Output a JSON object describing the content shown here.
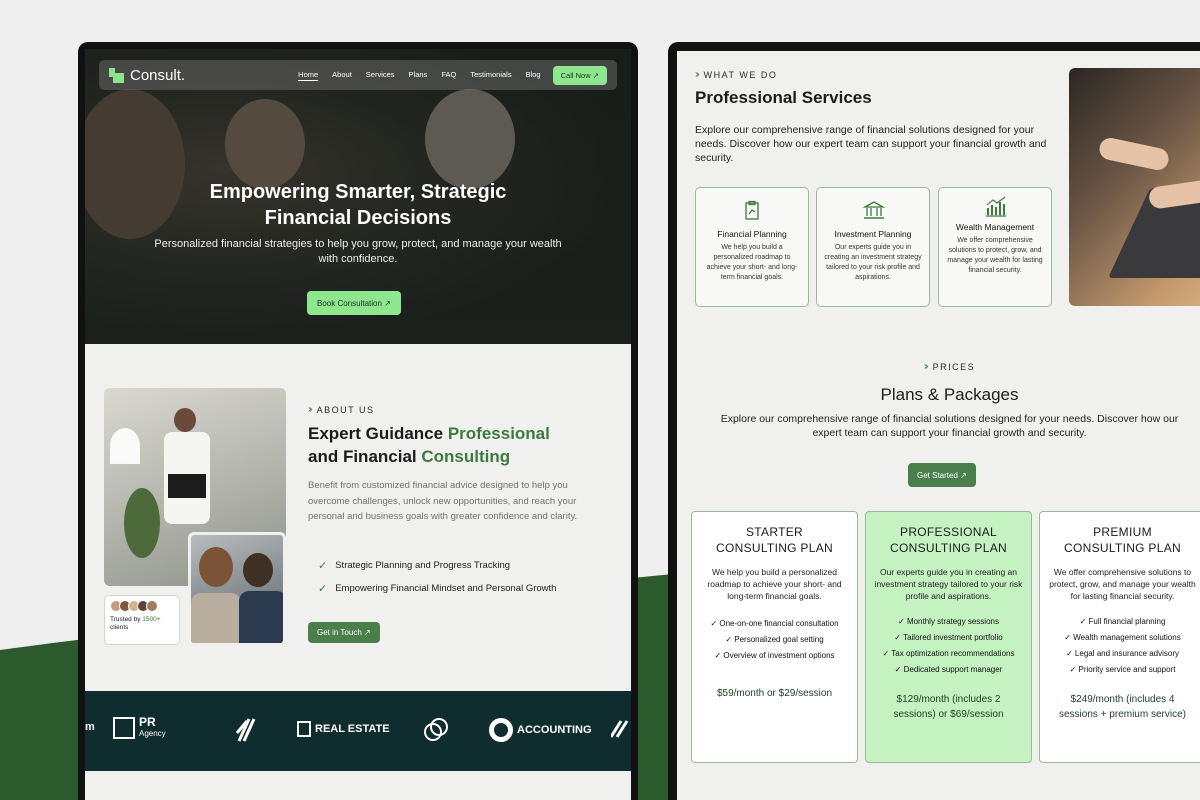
{
  "colors": {
    "accent": "#3d7a3e",
    "bright_green": "#8ee68e",
    "dark_teal": "#0f2d2e"
  },
  "left": {
    "nav": {
      "logo": "Consult.",
      "items": [
        "Home",
        "About",
        "Services",
        "Plans",
        "FAQ",
        "Testimonials",
        "Blog"
      ],
      "cta": "Call Now ↗"
    },
    "hero": {
      "title_line1": "Empowering Smarter, Strategic",
      "title_line2": "Financial Decisions",
      "subtitle": "Personalized financial strategies to help you grow, protect, and manage your wealth with confidence.",
      "button": "Book Consultation ↗"
    },
    "about": {
      "tag": "ABOUT US",
      "title_a": "Expert Guidance ",
      "title_b": "Professional",
      "title_c": "and Financial ",
      "title_d": "Consulting",
      "desc": "Benefit from customized financial advice designed to help you overcome challenges, unlock new opportunities, and reach your personal and business goals with greater confidence and clarity.",
      "checks": [
        "Strategic Planning and Progress Tracking",
        "Empowering Financial Mindset and Personal Growth"
      ],
      "button": "Get in Touch ↗",
      "trust_pre": "Trusted by ",
      "trust_count": "1500+",
      "trust_post": "clients"
    },
    "logos": {
      "partial": "m",
      "pr": "PR",
      "pr_sub": "Agency",
      "realestate": "REAL ESTATE",
      "accounting": "ACCOUNTING"
    }
  },
  "right": {
    "services": {
      "tag": "WHAT WE DO",
      "title": "Professional Services",
      "desc": "Explore our comprehensive range of financial solutions designed for your needs.  Discover how our expert team can support your financial growth and security.",
      "cards": [
        {
          "title": "Financial Planning",
          "desc": "We help you build a personalized roadmap to achieve your short- and long-term financial goals.",
          "icon": "clipboard-chart-icon"
        },
        {
          "title": "Investment Planning",
          "desc": "Our experts guide you in creating an investment strategy tailored to your risk profile and aspirations.",
          "icon": "bank-icon"
        },
        {
          "title": "Wealth Management",
          "desc": "We offer comprehensive solutions to protect, grow, and manage your wealth for lasting financial security.",
          "icon": "bar-chart-icon"
        }
      ]
    },
    "pricing": {
      "tag": "PRICES",
      "title": "Plans & Packages",
      "desc": "Explore our comprehensive range of financial solutions designed for your needs. Discover how our expert team can support your financial growth and security.",
      "button": "Get Started ↗",
      "plans": [
        {
          "title1": "STARTER",
          "title2": "CONSULTING PLAN",
          "desc": "We help you build a personalized roadmap to achieve your short- and long-term financial goals.",
          "features": [
            "✓ One-on-one financial consultation",
            "✓ Personalized goal setting",
            "✓ Overview of investment options"
          ],
          "price": "$59/month or $29/session"
        },
        {
          "title1": "PROFESSIONAL",
          "title2": "CONSULTING PLAN",
          "desc": "Our experts guide you in creating an investment strategy tailored to your risk profile and aspirations.",
          "features": [
            "✓ Monthly strategy sessions",
            "✓ Tailored investment portfolio",
            "✓ Tax optimization recommendations",
            "✓ Dedicated support manager"
          ],
          "price": "$129/month (includes 2 sessions) or $69/session"
        },
        {
          "title1": "PREMIUM",
          "title2": "CONSULTING PLAN",
          "desc": "We offer comprehensive solutions to protect, grow, and manage your wealth for lasting financial security.",
          "features": [
            "✓ Full financial planning",
            "✓ Wealth management solutions",
            "✓ Legal and insurance advisory",
            "✓ Priority service and support"
          ],
          "price": "$249/month (includes 4 sessions + premium service)"
        }
      ]
    }
  }
}
